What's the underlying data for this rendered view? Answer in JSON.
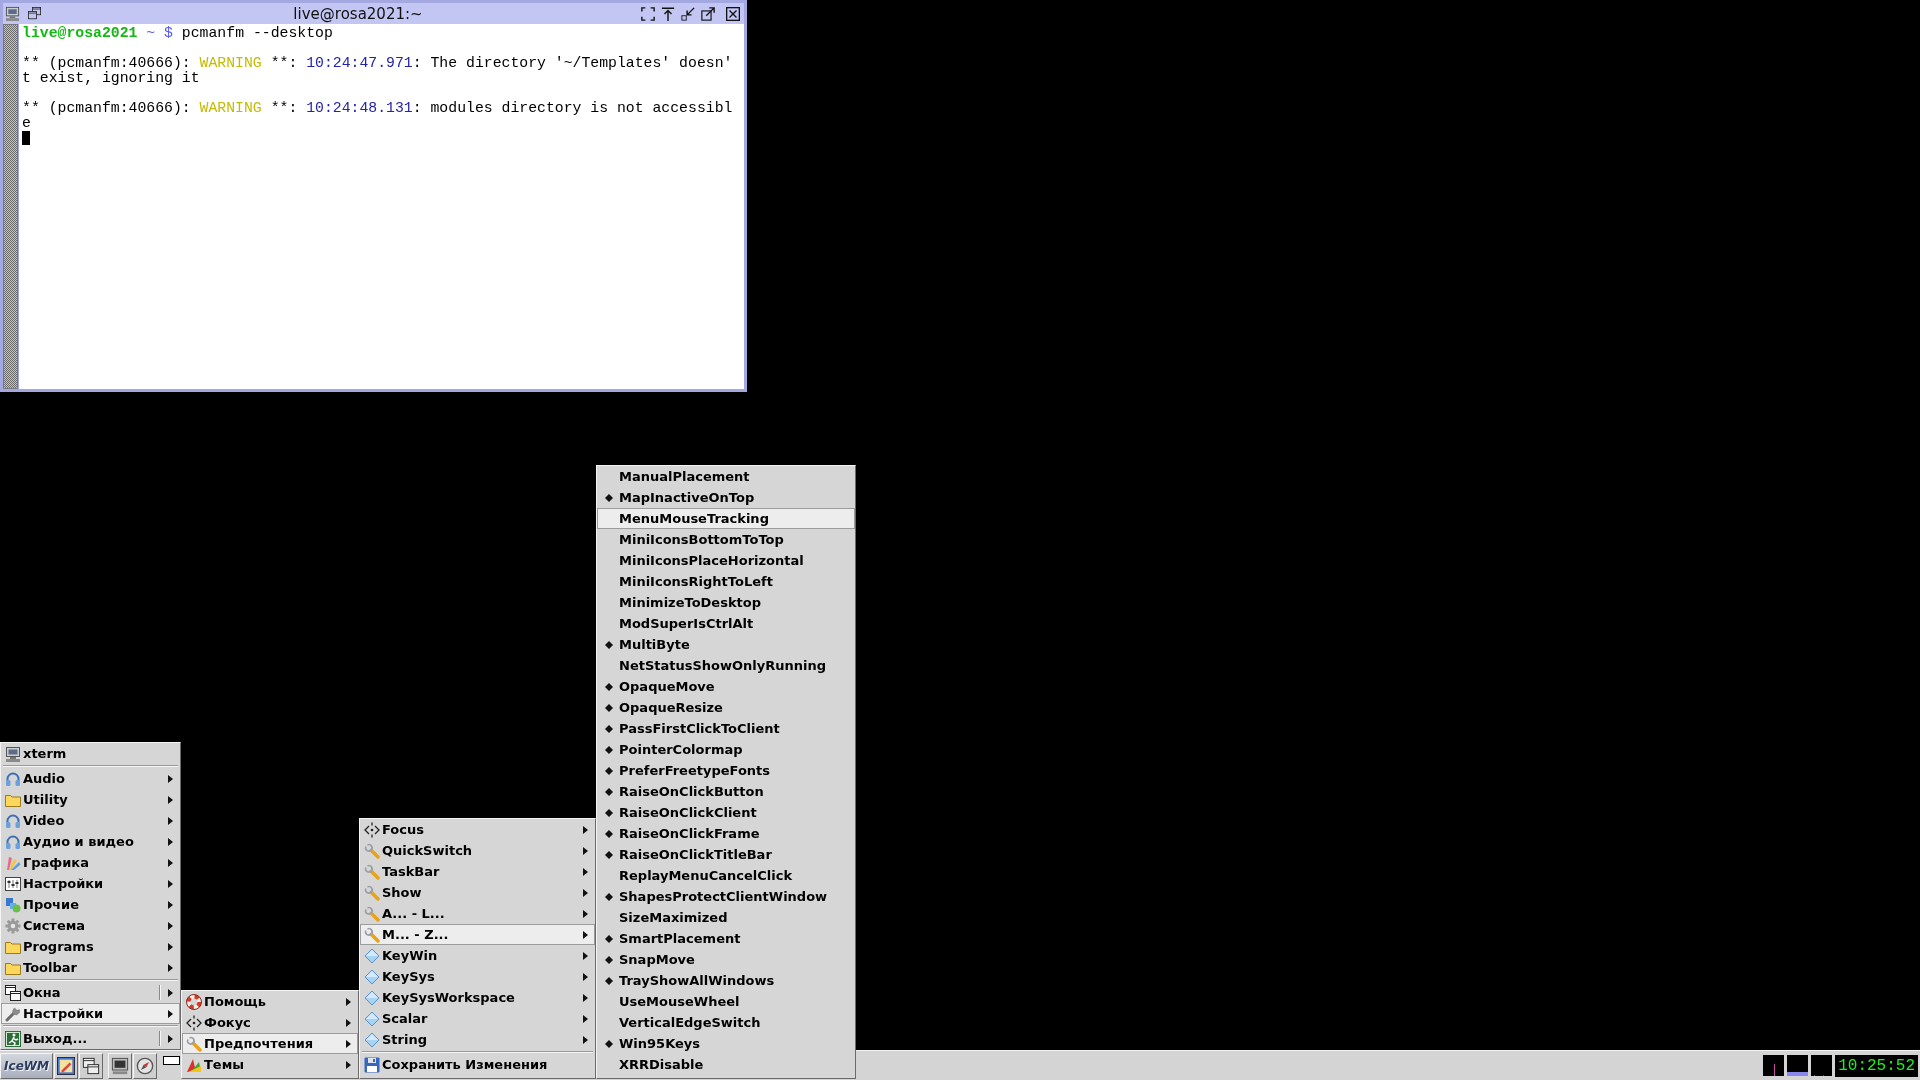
{
  "terminal": {
    "title": "live@rosa2021:~",
    "blocks": [
      {
        "lines": [
          {
            "segments": [
              {
                "kind": "user",
                "text": "live@rosa2021"
              },
              {
                "kind": "prompt",
                "text": " ~ $"
              },
              {
                "kind": "plain",
                "text": " pcmanfm --desktop"
              }
            ]
          }
        ]
      },
      {
        "lines": [
          {
            "segments": [
              {
                "kind": "plain",
                "text": "** (pcmanfm:40666): "
              },
              {
                "kind": "warning",
                "text": "WARNING"
              },
              {
                "kind": "plain",
                "text": " **: "
              },
              {
                "kind": "time",
                "text": "10:24:47.971"
              },
              {
                "kind": "plain",
                "text": ": The directory '~/Templates' doesn'"
              }
            ]
          },
          {
            "segments": [
              {
                "kind": "plain",
                "text": "t exist, ignoring it"
              }
            ]
          }
        ]
      },
      {
        "lines": [
          {
            "segments": [
              {
                "kind": "plain",
                "text": "** (pcmanfm:40666): "
              },
              {
                "kind": "warning",
                "text": "WARNING"
              },
              {
                "kind": "plain",
                "text": " **: "
              },
              {
                "kind": "time",
                "text": "10:24:48.131"
              },
              {
                "kind": "plain",
                "text": ": modules directory is not accessibl"
              }
            ]
          },
          {
            "segments": [
              {
                "kind": "plain",
                "text": "e"
              }
            ]
          }
        ]
      }
    ],
    "cursor_visible": true
  },
  "start_menu": {
    "sections": [
      {
        "items": [
          {
            "label": "xterm",
            "has_submenu": false,
            "split": false,
            "selected": false
          }
        ]
      },
      {
        "items": [
          {
            "label": "Audio",
            "has_submenu": true,
            "split": false,
            "selected": false
          },
          {
            "label": "Utility",
            "has_submenu": true,
            "split": false,
            "selected": false
          },
          {
            "label": "Video",
            "has_submenu": true,
            "split": false,
            "selected": false
          },
          {
            "label": "Аудио и видео",
            "has_submenu": true,
            "split": false,
            "selected": false
          },
          {
            "label": "Графика",
            "has_submenu": true,
            "split": false,
            "selected": false
          },
          {
            "label": "Настройки",
            "has_submenu": true,
            "split": false,
            "selected": false
          },
          {
            "label": "Прочие",
            "has_submenu": true,
            "split": false,
            "selected": false
          },
          {
            "label": "Система",
            "has_submenu": true,
            "split": false,
            "selected": false
          },
          {
            "label": "Programs",
            "has_submenu": true,
            "split": false,
            "selected": false
          },
          {
            "label": "Toolbar",
            "has_submenu": true,
            "split": false,
            "selected": false
          }
        ]
      },
      {
        "items": [
          {
            "label": "Окна",
            "has_submenu": true,
            "split": true,
            "selected": false
          },
          {
            "label": "Настройки",
            "has_submenu": true,
            "split": false,
            "selected": true
          }
        ]
      },
      {
        "items": [
          {
            "label": "Выход...",
            "has_submenu": true,
            "split": true,
            "selected": false
          }
        ]
      }
    ]
  },
  "submenus": [
    {
      "sections": [
        {
          "items": [
            {
              "label": "Помощь",
              "has_submenu": true,
              "selected": false
            },
            {
              "label": "Фокус",
              "has_submenu": true,
              "selected": false
            },
            {
              "label": "Предпочтения",
              "has_submenu": true,
              "selected": true
            },
            {
              "label": "Темы",
              "has_submenu": true,
              "selected": false
            }
          ]
        }
      ]
    },
    {
      "sections": [
        {
          "items": [
            {
              "label": "Focus",
              "has_submenu": true,
              "selected": false
            },
            {
              "label": "QuickSwitch",
              "has_submenu": true,
              "selected": false
            },
            {
              "label": "TaskBar",
              "has_submenu": true,
              "selected": false
            },
            {
              "label": "Show",
              "has_submenu": true,
              "selected": false
            },
            {
              "label": "A... - L...",
              "has_submenu": true,
              "selected": false
            },
            {
              "label": "M... - Z...",
              "has_submenu": true,
              "selected": true
            },
            {
              "label": "KeyWin",
              "has_submenu": true,
              "selected": false
            },
            {
              "label": "KeySys",
              "has_submenu": true,
              "selected": false
            },
            {
              "label": "KeySysWorkspace",
              "has_submenu": true,
              "selected": false
            },
            {
              "label": "Scalar",
              "has_submenu": true,
              "selected": false
            },
            {
              "label": "String",
              "has_submenu": true,
              "selected": false
            }
          ]
        },
        {
          "items": [
            {
              "label": "Сохранить Изменения",
              "has_submenu": false,
              "selected": false
            }
          ]
        }
      ]
    },
    {
      "sections": [
        {
          "items": [
            {
              "label": "ManualPlacement",
              "checked": false,
              "selected": false
            },
            {
              "label": "MapInactiveOnTop",
              "checked": true,
              "selected": false
            },
            {
              "label": "MenuMouseTracking",
              "checked": false,
              "selected": true
            },
            {
              "label": "MiniIconsBottomToTop",
              "checked": false,
              "selected": false
            },
            {
              "label": "MiniIconsPlaceHorizontal",
              "checked": false,
              "selected": false
            },
            {
              "label": "MiniIconsRightToLeft",
              "checked": false,
              "selected": false
            },
            {
              "label": "MinimizeToDesktop",
              "checked": false,
              "selected": false
            },
            {
              "label": "ModSuperIsCtrlAlt",
              "checked": false,
              "selected": false
            },
            {
              "label": "MultiByte",
              "checked": true,
              "selected": false
            },
            {
              "label": "NetStatusShowOnlyRunning",
              "checked": false,
              "selected": false
            },
            {
              "label": "OpaqueMove",
              "checked": true,
              "selected": false
            },
            {
              "label": "OpaqueResize",
              "checked": true,
              "selected": false
            },
            {
              "label": "PassFirstClickToClient",
              "checked": true,
              "selected": false
            },
            {
              "label": "PointerColormap",
              "checked": true,
              "selected": false
            },
            {
              "label": "PreferFreetypeFonts",
              "checked": true,
              "selected": false
            },
            {
              "label": "RaiseOnClickButton",
              "checked": true,
              "selected": false
            },
            {
              "label": "RaiseOnClickClient",
              "checked": true,
              "selected": false
            },
            {
              "label": "RaiseOnClickFrame",
              "checked": true,
              "selected": false
            },
            {
              "label": "RaiseOnClickTitleBar",
              "checked": true,
              "selected": false
            },
            {
              "label": "ReplayMenuCancelClick",
              "checked": false,
              "selected": false
            },
            {
              "label": "ShapesProtectClientWindow",
              "checked": true,
              "selected": false
            },
            {
              "label": "SizeMaximized",
              "checked": false,
              "selected": false
            },
            {
              "label": "SmartPlacement",
              "checked": true,
              "selected": false
            },
            {
              "label": "SnapMove",
              "checked": true,
              "selected": false
            },
            {
              "label": "TrayShowAllWindows",
              "checked": true,
              "selected": false
            },
            {
              "label": "UseMouseWheel",
              "checked": false,
              "selected": false
            },
            {
              "label": "VerticalEdgeSwitch",
              "checked": false,
              "selected": false
            },
            {
              "label": "Win95Keys",
              "checked": true,
              "selected": false
            },
            {
              "label": "XRRDisable",
              "checked": false,
              "selected": false
            }
          ]
        }
      ]
    }
  ],
  "taskbar": {
    "start_label": "IceWM",
    "clock": "10:25:52"
  }
}
